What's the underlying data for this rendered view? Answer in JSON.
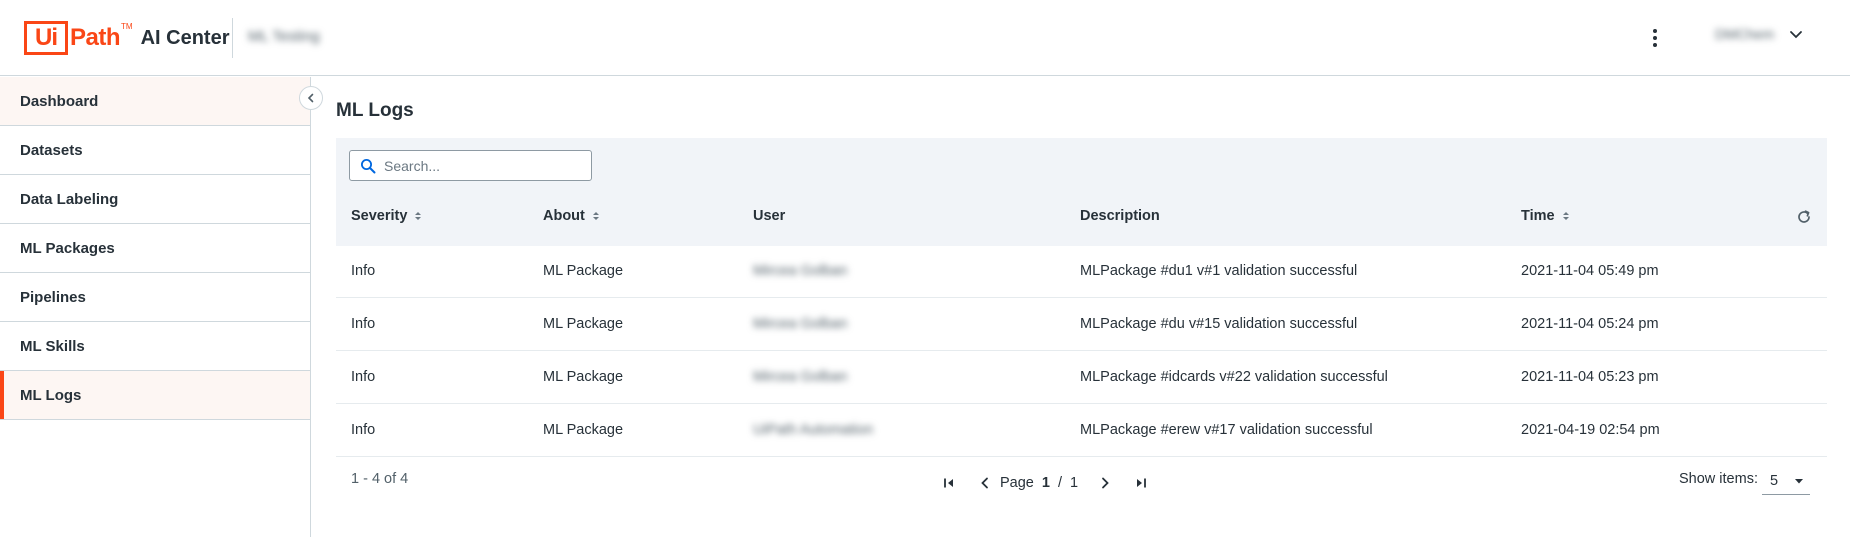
{
  "header": {
    "logo_ui": "Ui",
    "logo_path": "Path",
    "logo_tm": "TM",
    "product": "AI Center",
    "tenant": "ML Testing",
    "user": "DMChem"
  },
  "sidebar": {
    "items": [
      {
        "label": "Dashboard"
      },
      {
        "label": "Datasets"
      },
      {
        "label": "Data Labeling"
      },
      {
        "label": "ML Packages"
      },
      {
        "label": "Pipelines"
      },
      {
        "label": "ML Skills"
      },
      {
        "label": "ML Logs"
      }
    ],
    "active": "ML Logs"
  },
  "main": {
    "title": "ML Logs",
    "search_placeholder": "Search...",
    "columns": [
      "Severity",
      "About",
      "User",
      "Description",
      "Time"
    ],
    "rows": [
      {
        "severity": "Info",
        "about": "ML Package",
        "user": "Mircea Golban",
        "description": "MLPackage #du1 v#1 validation successful",
        "time": "2021-11-04 05:49 pm"
      },
      {
        "severity": "Info",
        "about": "ML Package",
        "user": "Mircea Golban",
        "description": "MLPackage #du v#15 validation successful",
        "time": "2021-11-04 05:24 pm"
      },
      {
        "severity": "Info",
        "about": "ML Package",
        "user": "Mircea Golban",
        "description": "MLPackage #idcards v#22 validation successful",
        "time": "2021-11-04 05:23 pm"
      },
      {
        "severity": "Info",
        "about": "ML Package",
        "user": "UiPath Automation",
        "description": "MLPackage #erew v#17 validation successful",
        "time": "2021-04-19 02:54 pm"
      }
    ],
    "footer": {
      "range": "1 - 4 of 4",
      "page_label": "Page",
      "page_current": "1",
      "page_sep": "/",
      "page_total": "1",
      "show_items_label": "Show items:",
      "show_items_value": "5"
    }
  },
  "colors": {
    "brand": "#fa4616",
    "text": "#273139",
    "toolbar_bg": "#f1f4f8",
    "active_bg": "#fdf6f3",
    "search_icon": "#0067df"
  },
  "icons": {
    "search": "search-icon",
    "kebab": "more-vert-icon",
    "user_menu": "chevron-down-icon",
    "collapse": "chevron-left-icon",
    "sort": "sort-icon",
    "refresh": "refresh-icon",
    "first": "first-page-icon",
    "prev": "chevron-left-icon",
    "next": "chevron-right-icon",
    "last": "last-page-icon",
    "dropdown": "caret-down-icon"
  }
}
